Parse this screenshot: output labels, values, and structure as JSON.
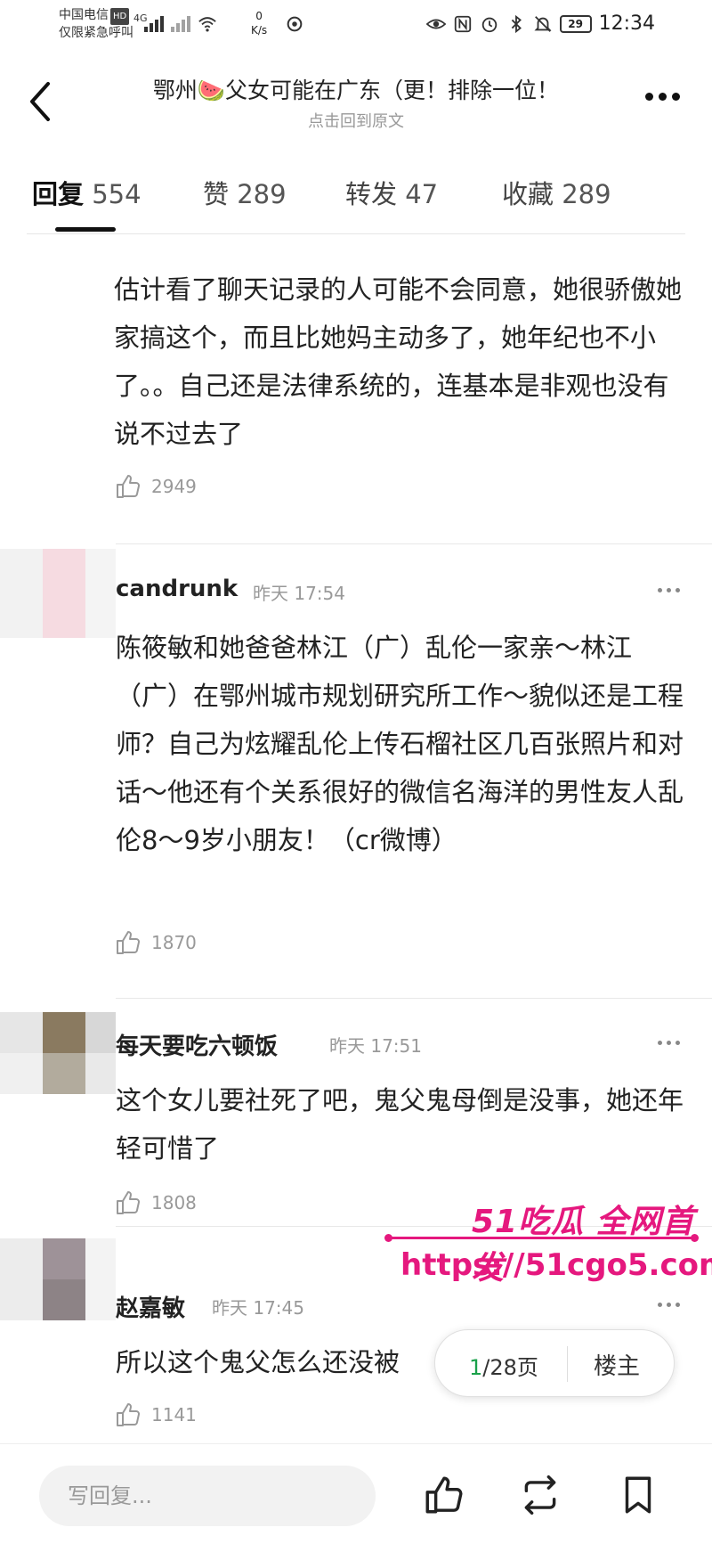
{
  "status_bar": {
    "carrier": "中国电信",
    "carrier_badge": "HD",
    "emergency": "仅限紧急呼叫",
    "network_4g": "4G",
    "speed_value": "0",
    "speed_unit": "K/s",
    "battery": "29",
    "time": "12:34"
  },
  "header": {
    "title": "鄂州🍉父女可能在广东（更！排除一位！",
    "subtitle": "点击回到原文"
  },
  "tabs": [
    {
      "label": "回复",
      "count": "554"
    },
    {
      "label": "赞",
      "count": "289"
    },
    {
      "label": "转发",
      "count": "47"
    },
    {
      "label": "收藏",
      "count": "289"
    }
  ],
  "comments": [
    {
      "text": "估计看了聊天记录的人可能不会同意，她很骄傲她家搞这个，而且比她妈主动多了，她年纪也不小了。。自己还是法律系统的，连基本是非观也没有说不过去了",
      "likes": "2949"
    },
    {
      "name": "candrunk",
      "time": "昨天 17:54",
      "text": "陈筱敏和她爸爸林江（广）乱伦一家亲～林江（广）在鄂州城市规划研究所工作～貌似还是工程师？自己为炫耀乱伦上传石榴社区几百张照片和对话～他还有个关系很好的微信名海洋的男性友人乱伦8～9岁小朋友！（cr微博）",
      "likes": "1870"
    },
    {
      "name": "每天要吃六顿饭",
      "time": "昨天 17:51",
      "text": "这个女儿要社死了吧，鬼父鬼母倒是没事，她还年轻可惜了",
      "likes": "1808"
    },
    {
      "name": "赵嘉敏",
      "time": "昨天 17:45",
      "text": "所以这个鬼父怎么还没被",
      "likes": "1141"
    }
  ],
  "watermark": {
    "line1": "51吃瓜 全网首发",
    "line2": "https://51cgo5.com",
    "color": "#e5187e"
  },
  "pager": {
    "current": "1",
    "total_suffix": "/28页",
    "owner_label": "楼主"
  },
  "bottom_bar": {
    "reply_placeholder": "写回复..."
  },
  "colors": {
    "accent_green": "#1aa14a",
    "text": "#222222",
    "muted": "#999999"
  },
  "icons": [
    "chevron-left-icon",
    "more-icon",
    "thumb-up-icon",
    "repost-icon",
    "bookmark-icon",
    "wifi-icon",
    "eye-icon",
    "nfc-icon",
    "alarm-icon",
    "bluetooth-icon",
    "mute-bell-icon"
  ]
}
